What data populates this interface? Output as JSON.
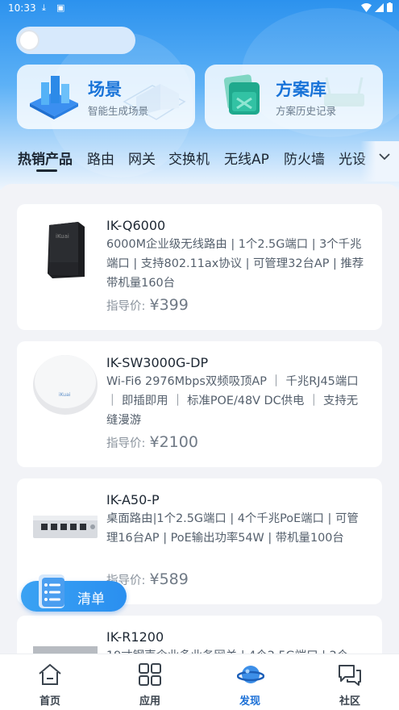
{
  "status_bar": {
    "time": "10:33"
  },
  "top_cards": [
    {
      "title": "场景",
      "subtitle": "智能生成场景"
    },
    {
      "title": "方案库",
      "subtitle": "方案历史记录"
    }
  ],
  "tabs": [
    {
      "label": "热销产品"
    },
    {
      "label": "路由"
    },
    {
      "label": "网关"
    },
    {
      "label": "交换机"
    },
    {
      "label": "无线AP"
    },
    {
      "label": "防火墙"
    },
    {
      "label": "光设"
    }
  ],
  "products": [
    {
      "name": "IK-Q6000",
      "description": "6000M企业级无线路由 | 1个2.5G端口 | 3个千兆端口 | 支持802.11ax协议 | 可管理32台AP | 推荐带机量160台",
      "price_label": "指导价:",
      "currency": "¥",
      "price": "399"
    },
    {
      "name": "IK-SW3000G-DP",
      "description": "Wi-Fi6 2976Mbps双频吸顶AP ｜ 千兆RJ45端口 ｜ 即插即用 ｜ 标准POE/48V DC供电 ｜ 支持无缝漫游",
      "price_label": "指导价:",
      "currency": "¥",
      "price": "2100"
    },
    {
      "name": "IK-A50-P",
      "description": "桌面路由|1个2.5G端口 | 4个千兆PoE端口 | 可管理16台AP | PoE输出功率54W | 带机量100台",
      "price_label": "指导价:",
      "currency": "¥",
      "price": "589"
    },
    {
      "name": "IK-R1200",
      "description": "19寸钢壳企业多业务网关 | 4个2.5G端口 | 2个",
      "price_label": "",
      "currency": "",
      "price": ""
    }
  ],
  "fab": {
    "label": "清单"
  },
  "bottom_nav": [
    {
      "label": "首页"
    },
    {
      "label": "应用"
    },
    {
      "label": "发现"
    },
    {
      "label": "社区"
    }
  ],
  "colors": {
    "accent": "#1c70d6",
    "hero_top": "#2c92ee",
    "background": "#f2f3f7"
  }
}
